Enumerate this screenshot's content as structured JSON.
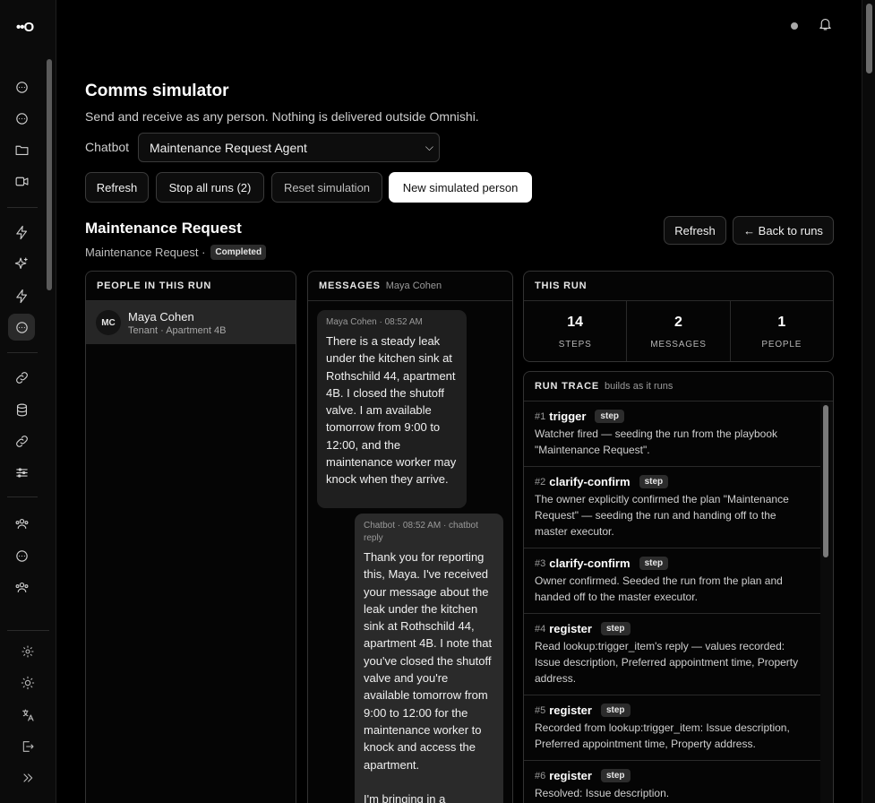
{
  "app": {
    "logo_text": "••O"
  },
  "rail": {
    "nav_icons": [
      "chat-bubble-icon",
      "chat-bubble-icon",
      "folder-icon",
      "video-icon",
      "bolt-icon",
      "sparkles-icon",
      "bolt-icon",
      "chat-bubble-icon",
      "link-icon",
      "database-icon",
      "link-icon",
      "sliders-icon",
      "users-icon",
      "chat-bubble-icon",
      "users-icon"
    ],
    "bottom_icons": [
      "gear-icon",
      "sun-icon",
      "translate-icon",
      "logout-icon",
      "expand-icon"
    ]
  },
  "header": {
    "notifications_icon": "bell-icon"
  },
  "simulator": {
    "title": "Comms simulator",
    "subtitle": "Send and receive as any person. Nothing is delivered outside Omnishi.",
    "chatbot_label": "Chatbot",
    "chatbot_value": "Maintenance Request Agent",
    "buttons": {
      "refresh": "Refresh",
      "stop_all": "Stop all runs (2)",
      "reset": "Reset simulation",
      "new_person": "New simulated person"
    }
  },
  "run": {
    "title": "Maintenance Request",
    "subtitle": "Maintenance Request ·",
    "status": "Completed",
    "refresh_label": "Refresh",
    "back_label": "← Back to runs"
  },
  "people": {
    "header": "PEOPLE IN THIS RUN",
    "items": [
      {
        "initials": "MC",
        "name": "Maya Cohen",
        "role": "Tenant · Apartment 4B"
      }
    ]
  },
  "messages": {
    "header": "MESSAGES",
    "header_hint": "Maya Cohen",
    "items": [
      {
        "meta": "Maya Cohen · 08:52 AM",
        "text": "There is a steady leak under the kitchen sink at Rothschild 44, apartment 4B. I closed the shutoff valve. I am available tomorrow from 9:00 to 12:00, and the maintenance worker may knock when they arrive."
      },
      {
        "meta": "Chatbot · 08:52 AM · chatbot reply",
        "text": "Thank you for reporting this, Maya. I've received your message about the leak under the kitchen sink at Rothschild 44, apartment 4B. I note that you've closed the shutoff valve and you're available tomorrow from 9:00 to 12:00 for the maintenance worker to knock and access the apartment.\n\nI'm bringing in a"
      }
    ]
  },
  "this_run": {
    "header": "THIS RUN",
    "stats": [
      {
        "value": "14",
        "label": "STEPS"
      },
      {
        "value": "2",
        "label": "MESSAGES"
      },
      {
        "value": "1",
        "label": "PEOPLE"
      }
    ]
  },
  "trace": {
    "header": "RUN TRACE",
    "header_hint": "builds as it runs",
    "items": [
      {
        "index": "#1",
        "name": "trigger",
        "kind": "step",
        "desc": "Watcher fired — seeding the run from the playbook \"Maintenance Request\"."
      },
      {
        "index": "#2",
        "name": "clarify-confirm",
        "kind": "step",
        "desc": "The owner explicitly confirmed the plan \"Maintenance Request\" — seeding the run and handing off to the master executor."
      },
      {
        "index": "#3",
        "name": "clarify-confirm",
        "kind": "step",
        "desc": "Owner confirmed. Seeded the run from the plan and handed off to the master executor."
      },
      {
        "index": "#4",
        "name": "register",
        "kind": "step",
        "desc": "Read lookup:trigger_item's reply — values recorded: Issue description, Preferred appointment time, Property address."
      },
      {
        "index": "#5",
        "name": "register",
        "kind": "step",
        "desc": "Recorded from lookup:trigger_item: Issue description, Preferred appointment time, Property address."
      },
      {
        "index": "#6",
        "name": "register",
        "kind": "step",
        "desc": "Resolved: Issue description."
      }
    ]
  }
}
